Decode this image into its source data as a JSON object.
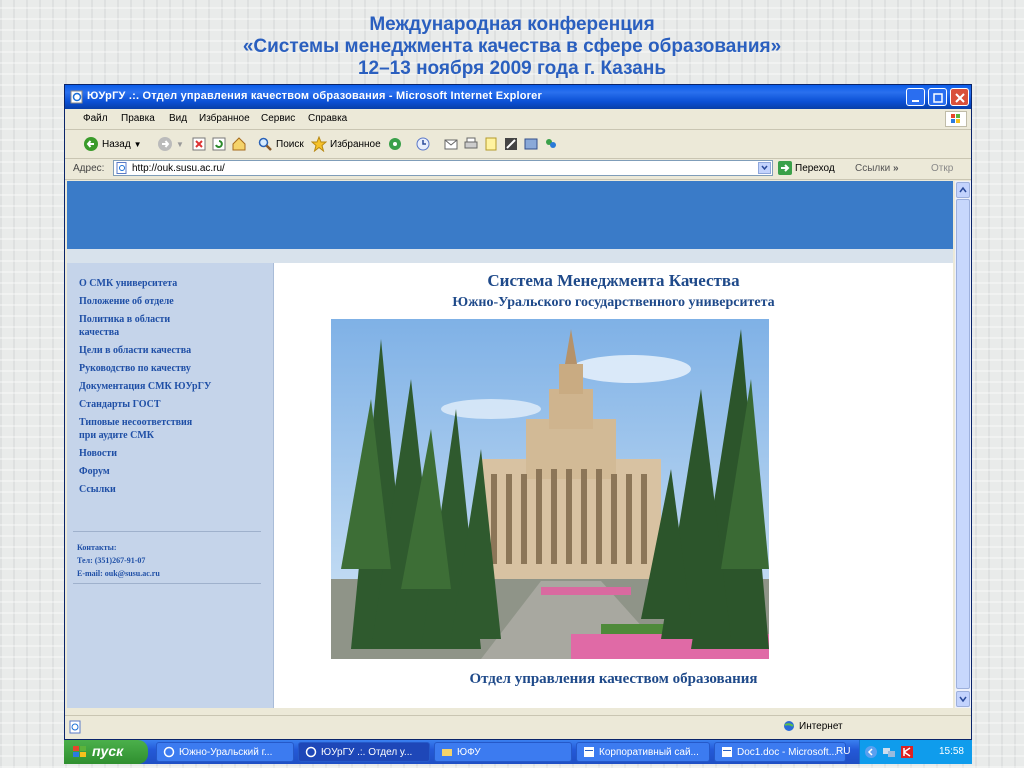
{
  "slide": {
    "title_line1": "Международная конференция",
    "title_line2": "«Системы менеджмента качества в сфере образования»",
    "title_line3": "12–13 ноября 2009 года г. Казань"
  },
  "window": {
    "title": "ЮУрГУ .:. Отдел управления качеством образования - Microsoft Internet Explorer",
    "menu": [
      "Файл",
      "Правка",
      "Вид",
      "Избранное",
      "Сервис",
      "Справка"
    ],
    "toolbar": {
      "back": "Назад",
      "search": "Поиск",
      "favorites": "Избранное"
    },
    "address": {
      "label": "Адрес:",
      "url": "http://ouk.susu.ac.ru/",
      "go": "Переход",
      "links": "Ссылки",
      "open": "Откр"
    },
    "status": {
      "zone": "Интернет"
    }
  },
  "site": {
    "nav": [
      "О СМК университета",
      "Положение об отделе",
      "Политика в области\nкачества",
      "Цели в области качества",
      "Руководство по качеству",
      "Документация СМК ЮУрГУ",
      "Стандарты ГОСТ",
      "Типовые несоответствия\nпри аудите СМК",
      "Новости",
      "Форум",
      "Ссылки"
    ],
    "contacts": {
      "heading": "Контакты:",
      "phone": "Тел: (351)267-91-07",
      "email": "E-mail: ouk@susu.ac.ru"
    },
    "main_title": "Система Менеджмента Качества",
    "main_subtitle": "Южно-Уральского государственного университета",
    "main_footer": "Отдел управления качеством образования"
  },
  "taskbar": {
    "start": "пуск",
    "tasks": [
      "Южно-Уральский г...",
      "ЮУрГУ .:. Отдел у...",
      "ЮФУ",
      "Корпоративный сай...",
      "Doc1.doc - Microsoft..."
    ],
    "lang": "RU",
    "clock": "15:58"
  },
  "colors": {
    "slide_title": "#2a5fbf",
    "site_header": "#3a7bc8",
    "sidebar": "#c5d4ea",
    "nav_link": "#1f4fa6",
    "main_text": "#1f4a8a"
  }
}
